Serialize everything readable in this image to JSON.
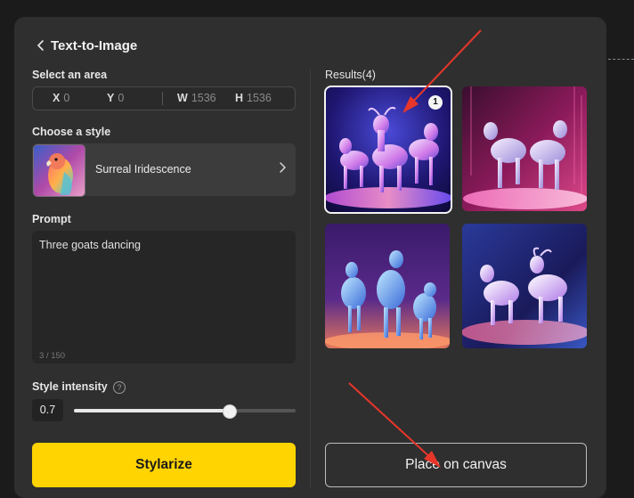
{
  "panel": {
    "title": "Text-to-Image"
  },
  "area": {
    "label": "Select an area",
    "x_key": "X",
    "x_value": "0",
    "y_key": "Y",
    "y_value": "0",
    "w_key": "W",
    "w_value": "1536",
    "h_key": "H",
    "h_value": "1536"
  },
  "style": {
    "label": "Choose a style",
    "selected_name": "Surreal Iridescence"
  },
  "prompt": {
    "label": "Prompt",
    "value": "Three goats dancing",
    "char_count": "3 / 150"
  },
  "intensity": {
    "label": "Style intensity",
    "value": "0.7",
    "level": 0.7
  },
  "actions": {
    "stylarize_label": "Stylarize",
    "place_label": "Place on canvas"
  },
  "results": {
    "label": "Results(4)",
    "selected_badge": "1",
    "items": [
      {
        "icon": "goat-image",
        "selected": true
      },
      {
        "icon": "goat-image",
        "selected": false
      },
      {
        "icon": "goat-image",
        "selected": false
      },
      {
        "icon": "goat-image",
        "selected": false
      }
    ]
  },
  "colors": {
    "accent_yellow": "#ffd400",
    "panel_bg": "#2f2f2f",
    "annotation_arrow": "#e8362a"
  },
  "icons": {
    "back": "chevron-left-icon",
    "style_next": "chevron-right-icon",
    "help": "question-circle-icon"
  }
}
